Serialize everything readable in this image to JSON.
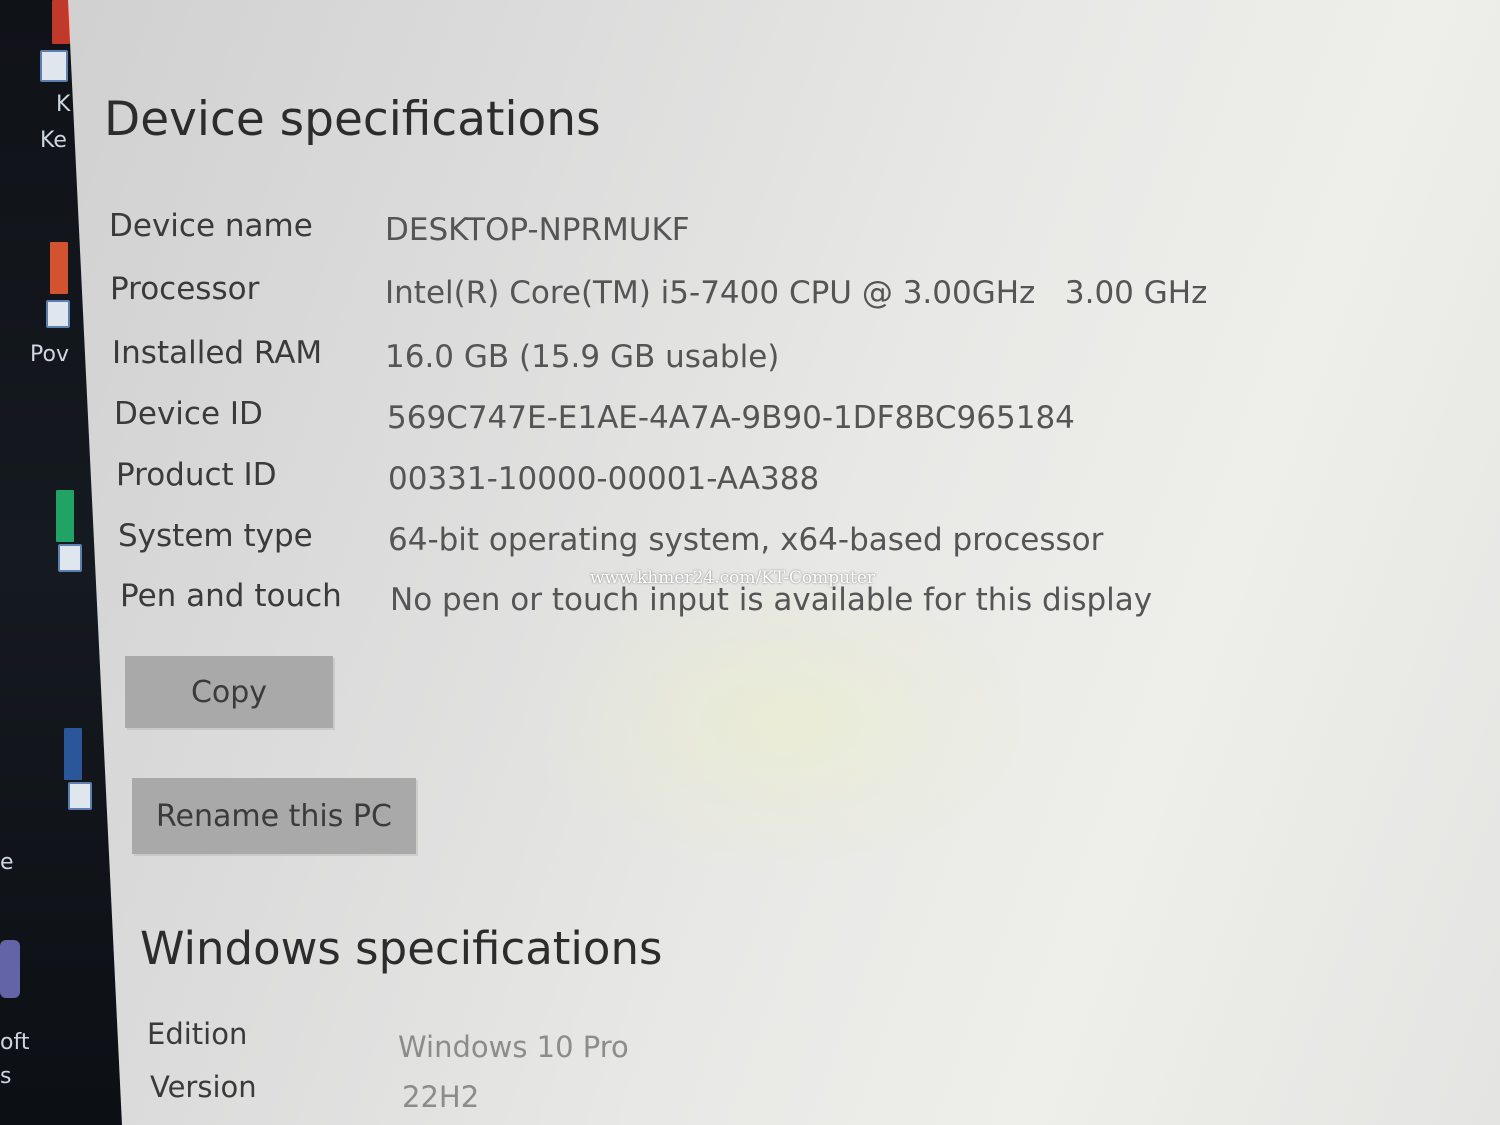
{
  "desktop": {
    "label_ke": "Ke",
    "label_k": "K",
    "label_pov": "Pov",
    "label_oft": "oft",
    "label_s": "s",
    "label_e": "e"
  },
  "device_specifications": {
    "title": "Device specifications",
    "rows": [
      {
        "label": "Device name",
        "value": "DESKTOP-NPRMUKF"
      },
      {
        "label": "Processor",
        "value": "Intel(R) Core(TM) i5-7400 CPU @ 3.00GHz   3.00 GHz"
      },
      {
        "label": "Installed RAM",
        "value": "16.0 GB (15.9 GB usable)"
      },
      {
        "label": "Device ID",
        "value": "569C747E-E1AE-4A7A-9B90-1DF8BC965184"
      },
      {
        "label": "Product ID",
        "value": "00331-10000-00001-AA388"
      },
      {
        "label": "System type",
        "value": "64-bit operating system, x64-based processor"
      },
      {
        "label": "Pen and touch",
        "value": "No pen or touch input is available for this display"
      }
    ],
    "copy_button": "Copy",
    "rename_button": "Rename this PC"
  },
  "windows_specifications": {
    "title": "Windows specifications",
    "rows": [
      {
        "label": "Edition",
        "value": "Windows 10 Pro"
      },
      {
        "label": "Version",
        "value": "22H2"
      }
    ]
  },
  "watermark": "www.khmer24.com/KT-Computer"
}
